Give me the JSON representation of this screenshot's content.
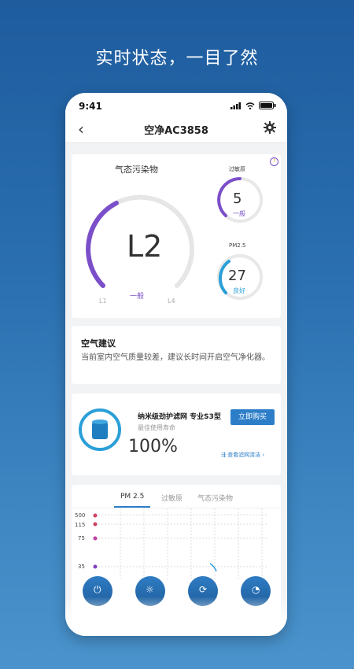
{
  "promo": {
    "headline": "实时状态，一目了然"
  },
  "status_bar": {
    "time": "9:41"
  },
  "nav": {
    "back_icon": "chevron-left-icon",
    "title": "空净AC3858",
    "settings_icon": "gear-icon"
  },
  "pollution": {
    "title": "气态污染物",
    "level": "L2",
    "status": "一般",
    "scale_min": "L1",
    "scale_max": "L4",
    "level_fraction": 0.33,
    "color": "#7b4fc9"
  },
  "allergen": {
    "label": "过敏原",
    "value": "5",
    "status": "一般",
    "color": "#7b4fc9"
  },
  "pm25": {
    "label": "PM2.5",
    "value": "27",
    "status": "良好",
    "color": "#2a9fd8"
  },
  "info_badge": "?",
  "advice": {
    "title": "空气建议",
    "text": "当前室内空气质量较差，建议长时间开启空气净化器。"
  },
  "filter": {
    "name": "纳米级劲护滤网 专业S3型",
    "subtitle": "最佳使用寿命",
    "life": "100%",
    "buy_label": "立即购买",
    "clean_link": "查看滤网清洁"
  },
  "history": {
    "tabs": [
      "PM 2.5",
      "过敏原",
      "气态污染物"
    ],
    "active_tab": 0,
    "y_ticks": [
      "500",
      "115",
      "75",
      "35"
    ]
  },
  "bottom_controls": [
    "power-icon",
    "brightness-icon",
    "mode-icon",
    "timer-icon"
  ]
}
